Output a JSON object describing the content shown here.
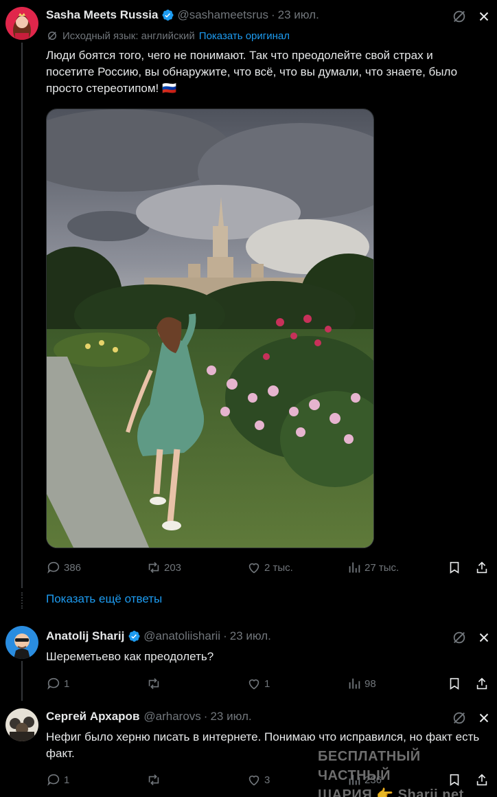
{
  "post1": {
    "name": "Sasha Meets Russia",
    "handle": "@sashameetsrus",
    "date": "23 июл.",
    "translation_note": "Исходный язык: английский",
    "show_original": "Показать оригинал",
    "text": "Люди боятся того, чего не понимают. Так что преодолейте свой страх и посетите Россию, вы обнаружите, что всё, что вы думали, что знаете, было просто стереотипом! 🇷🇺",
    "replies": "386",
    "reposts": "203",
    "likes": "2 тыс.",
    "views": "27 тыс."
  },
  "show_more_replies": "Показать ещё ответы",
  "post2": {
    "name": "Anatolij Sharij",
    "handle": "@anatoliisharii",
    "date": "23 июл.",
    "text": "Шереметьево как преодолеть?",
    "replies": "1",
    "reposts": "",
    "likes": "1",
    "views": "98"
  },
  "post3": {
    "name": "Сергей Архаров",
    "handle": "@arharovs",
    "date": "23 июл.",
    "text": "Нефиг было херню писать в интернете. Понимаю что исправился, но факт есть факт.",
    "replies": "1",
    "reposts": "",
    "likes": "3",
    "views": "236"
  },
  "watermark": {
    "line1": "БЕСПЛАТНЫЙ ЧАСТНЫЙ",
    "line2": "ШАРИЯ 👉 Sharij.net"
  },
  "colors": {
    "accent": "#1d9bf0",
    "muted": "#71767b",
    "text": "#e7e9ea",
    "verified": "#1d9bf0"
  }
}
